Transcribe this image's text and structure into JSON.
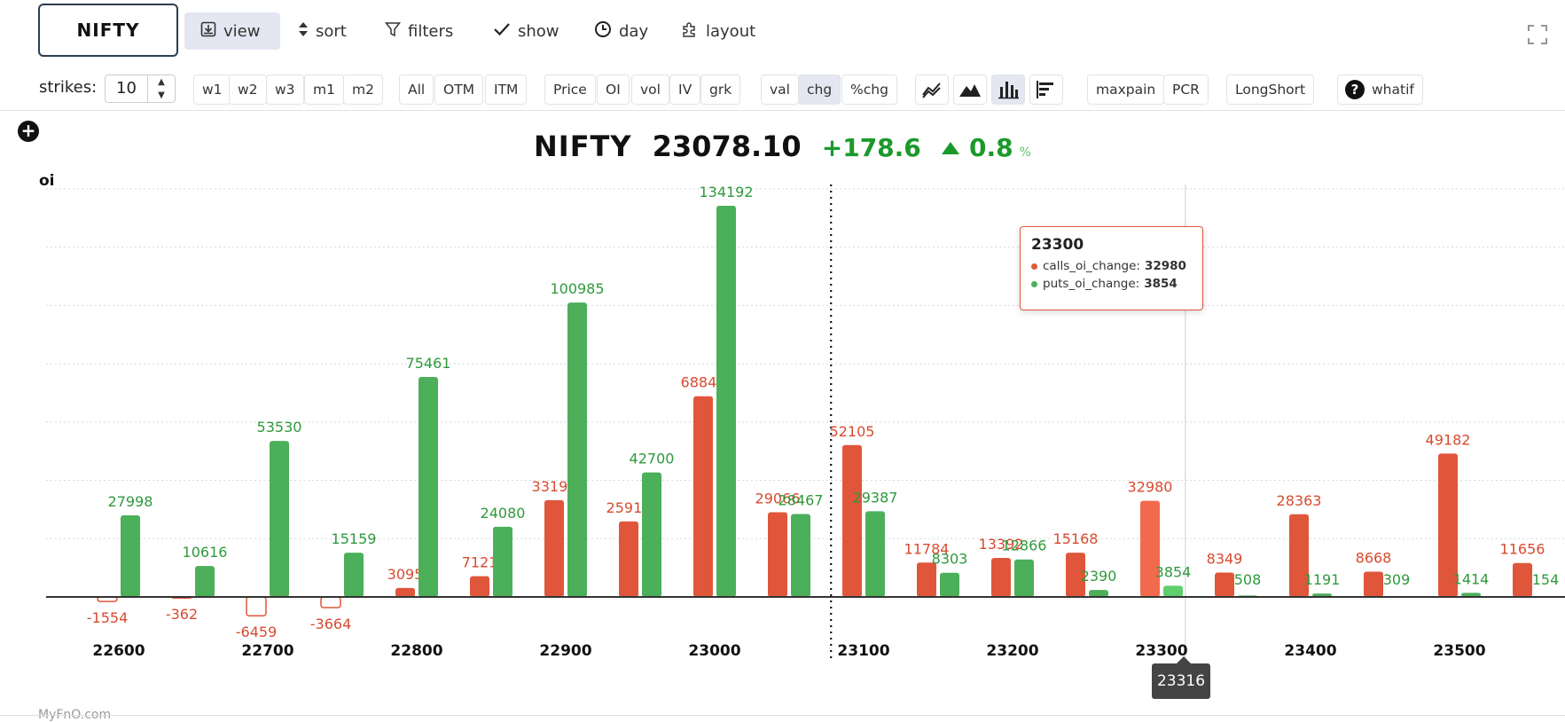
{
  "symbol_box": "NIFTY",
  "top_menu": [
    {
      "label": "view",
      "icon": "download-icon",
      "active": true
    },
    {
      "label": "sort",
      "icon": "sort-icon",
      "active": false
    },
    {
      "label": "filters",
      "icon": "filter-icon",
      "active": false
    },
    {
      "label": "show",
      "icon": "check-icon",
      "active": false
    },
    {
      "label": "day",
      "icon": "clock-icon",
      "active": false
    },
    {
      "label": "layout",
      "icon": "puzzle-icon",
      "active": false
    }
  ],
  "toolbar": {
    "strikes_label": "strikes:",
    "strikes_value": "10",
    "expiry": [
      "w1",
      "w2",
      "w3",
      "m1",
      "m2"
    ],
    "moneyness": [
      "All",
      "OTM",
      "ITM"
    ],
    "metrics": [
      "Price",
      "OI",
      "vol",
      "IV",
      "grk"
    ],
    "modes": [
      "val",
      "chg",
      "%chg"
    ],
    "selected_mode": "chg",
    "chart_types": [
      "line-chart-icon",
      "area-chart-icon",
      "bar-chart-icon",
      "horizontal-bar-icon"
    ],
    "selected_chart_type": "bar-chart-icon",
    "extra": [
      "maxpain",
      "PCR"
    ],
    "longshort": "LongShort",
    "whatif": "whatif"
  },
  "header": {
    "symbol": "NIFTY",
    "price": "23078.10",
    "change": "+178.6",
    "change_pct": "0.8",
    "pct_sign": "%"
  },
  "chart_data": {
    "type": "bar",
    "ylabel": "oi",
    "categories": [
      22600,
      22650,
      22700,
      22750,
      22800,
      22850,
      22900,
      22950,
      23000,
      23050,
      23100,
      23150,
      23200,
      23250,
      23300,
      23350,
      23400,
      23450,
      23500,
      23550
    ],
    "x_tick_labels": [
      "22600",
      "22700",
      "22800",
      "22900",
      "23000",
      "23100",
      "23200",
      "23300",
      "23400",
      "23500"
    ],
    "series": [
      {
        "name": "calls_oi_change",
        "color": "#e0563b",
        "values": [
          -1554,
          -362,
          -6459,
          -3664,
          3095,
          7121,
          33190,
          25912,
          68846,
          29066,
          52105,
          11784,
          13392,
          15168,
          32980,
          8349,
          28363,
          8668,
          49182,
          11656
        ]
      },
      {
        "name": "puts_oi_change",
        "color": "#4caf5a",
        "values": [
          27998,
          10616,
          53530,
          15159,
          75461,
          24080,
          100985,
          42700,
          134192,
          28467,
          29387,
          8303,
          12866,
          2390,
          3854,
          508,
          1191,
          309,
          1414,
          154
        ]
      }
    ],
    "data_labels": {
      "calls_oi_change": [
        "-1554",
        "-362",
        "-6459",
        "-3664",
        "3095",
        "7121",
        "33190",
        "25912",
        "68846",
        "29066",
        "52105",
        "11784",
        "13392",
        "15168",
        "32980",
        "8349",
        "28363",
        "8668",
        "49182",
        "11656"
      ],
      "puts_oi_change": [
        "27998",
        "10616",
        "53530",
        "15159",
        "75461",
        "24080",
        "100985",
        "42700",
        "134192",
        "28467",
        "29387",
        "8303",
        "12866",
        "2390",
        "3854",
        "508",
        "1191",
        "309",
        "1414",
        "154"
      ]
    },
    "ylim": [
      -10000,
      140000
    ],
    "grid": true,
    "spot_marker": 23078.1,
    "hover_x": 23316,
    "hover_label": "23316"
  },
  "tooltip": {
    "title": "23300",
    "rows": [
      {
        "name": "calls_oi_change:",
        "value": "32980",
        "color": "#e0563b"
      },
      {
        "name": "puts_oi_change:",
        "value": "3854",
        "color": "#4caf5a"
      }
    ]
  },
  "brand": "MyFnO.com",
  "colors": {
    "accent": "#e4e7f1",
    "positive": "#1a9a2a",
    "calls": "#e0563b",
    "puts": "#4caf5a"
  }
}
